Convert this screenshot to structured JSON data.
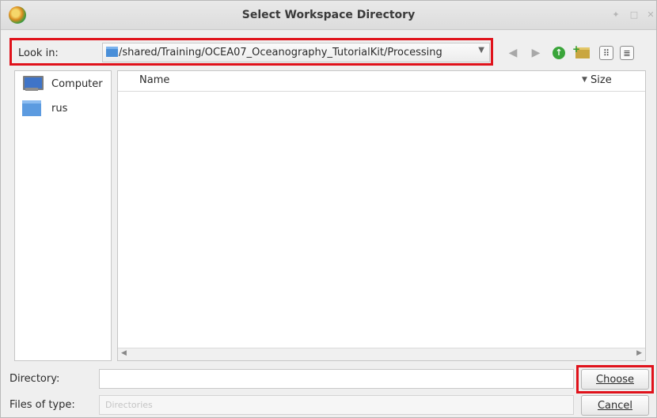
{
  "window": {
    "title": "Select Workspace Directory"
  },
  "toolbar": {
    "look_in_label": "Look in:",
    "path": "/shared/Training/OCEA07_Oceanography_TutorialKit/Processing",
    "buttons": [
      "back-icon",
      "forward-icon",
      "up-folder-icon",
      "new-folder-icon",
      "icon-view-icon",
      "detail-view-icon"
    ]
  },
  "sidebar": {
    "items": [
      {
        "label": "Computer",
        "icon": "computer-icon"
      },
      {
        "label": "rus",
        "icon": "home-folder-icon"
      }
    ]
  },
  "filelist": {
    "columns": [
      "Name",
      "Size"
    ]
  },
  "form": {
    "directory_label": "Directory:",
    "directory_value": "",
    "files_of_type_label": "Files of type:",
    "files_of_type_value": "Directories",
    "choose_label": "Choose",
    "cancel_label": "Cancel"
  },
  "highlight_color": "#e0121b"
}
